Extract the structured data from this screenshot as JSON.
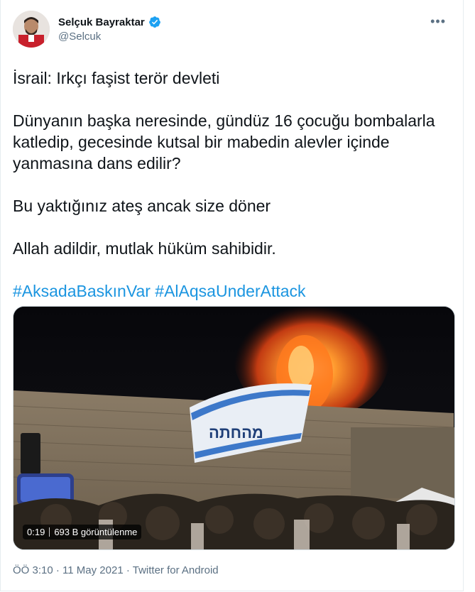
{
  "author": {
    "name": "Selçuk Bayraktar",
    "handle": "@Selcuk",
    "verified": true,
    "avatar_icon": "avatar-photo"
  },
  "menu": {
    "more_label": "•••"
  },
  "tweet": {
    "lines": [
      "İsrail: Irkçı faşist terör devleti",
      "Dünyanın başka neresinde, gündüz 16 çocuğu bombalarla katledip, gecesinde kutsal bir mabedin alevler içinde yanmasına dans edilir?",
      "Bu yaktığınız ateş ancak size döner",
      "Allah adildir, mutlak hüküm sahibidir."
    ],
    "hashtags": [
      "#AksadaBaskınVar",
      "#AlAqsaUnderAttack"
    ]
  },
  "video": {
    "duration": "0:19",
    "views": "693 B görüntülenme"
  },
  "meta": {
    "time": "ÖÖ 3:10",
    "separator1": " · ",
    "date": "11 May 2021",
    "separator2": " · ",
    "source": "Twitter for Android"
  },
  "colors": {
    "link": "#1b95e0",
    "secondary": "#5b7083",
    "verified": "#1da1f2"
  }
}
